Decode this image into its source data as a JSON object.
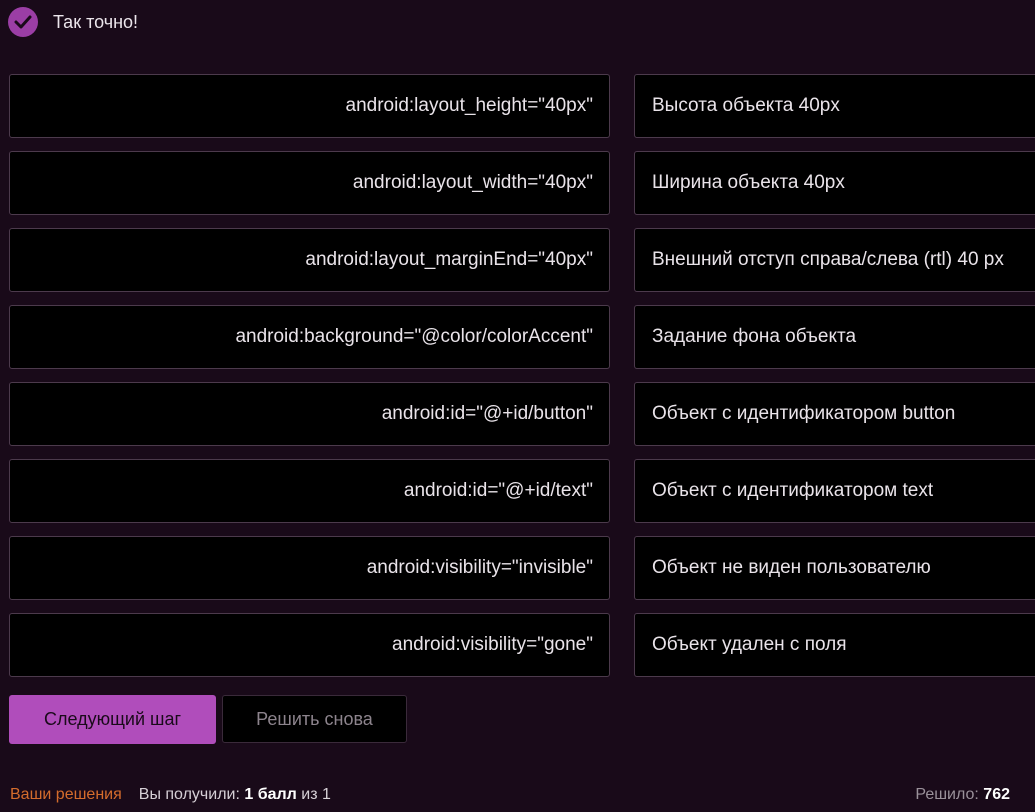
{
  "feedback": {
    "text": "Так точно!"
  },
  "pairs": [
    {
      "code": "android:layout_height=\"40px\"",
      "description": "Высота объекта 40px"
    },
    {
      "code": "android:layout_width=\"40px\"",
      "description": "Ширина объекта 40px"
    },
    {
      "code": "android:layout_marginEnd=\"40px\"",
      "description": "Внешний отступ справа/слева (rtl) 40 px"
    },
    {
      "code": "android:background=\"@color/colorAccent\"",
      "description": "Задание фона объекта"
    },
    {
      "code": "android:id=\"@+id/button\"",
      "description": "Объект с идентификатором button"
    },
    {
      "code": "android:id=\"@+id/text\"",
      "description": "Объект с идентификатором text"
    },
    {
      "code": "android:visibility=\"invisible\"",
      "description": "Объект не виден пользователю"
    },
    {
      "code": "android:visibility=\"gone\"",
      "description": "Объект удален с поля"
    }
  ],
  "actions": {
    "next_label": "Следующий шаг",
    "retry_label": "Решить снова"
  },
  "footer": {
    "solutions_link": "Ваши решения",
    "score_prefix": "Вы получили: ",
    "score_value": "1 балл",
    "score_suffix": " из 1",
    "solved_label": "Решило: ",
    "solved_count": "762"
  },
  "colors": {
    "background": "#190a19",
    "accent": "#b04dbb",
    "check": "#9b3ea5",
    "link": "#d46c2c"
  },
  "icons": {
    "feedback": "check-circle-icon"
  }
}
